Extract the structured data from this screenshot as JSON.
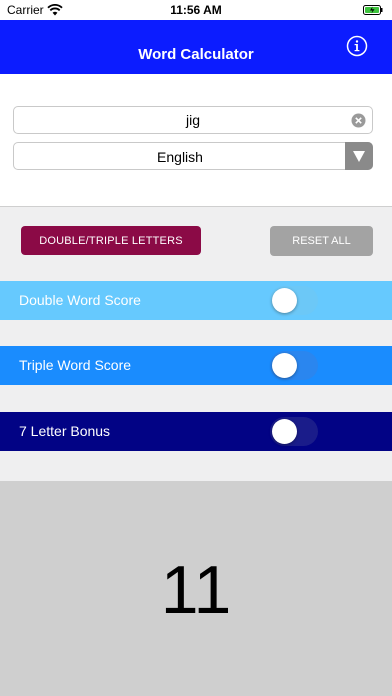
{
  "status_bar": {
    "carrier": "Carrier",
    "time": "11:56 AM"
  },
  "header": {
    "title": "Word Calculator",
    "info_icon": "info-icon"
  },
  "word_input": {
    "value": "jig",
    "clear_icon": "clear-icon"
  },
  "language": {
    "selected": "English",
    "dropdown_icon": "triangle-down-icon"
  },
  "buttons": {
    "double_triple": "DOUBLE/TRIPLE LETTERS",
    "reset": "RESET ALL"
  },
  "options": [
    {
      "label": "Double Word Score",
      "on": false,
      "color": "#66c9fe"
    },
    {
      "label": "Triple Word Score",
      "on": false,
      "color": "#1a8cfe"
    },
    {
      "label": "7 Letter Bonus",
      "on": false,
      "color": "#020385"
    }
  ],
  "score": "11",
  "colors": {
    "header": "#0c1cff",
    "letters_button": "#8b0a46",
    "reset_button": "#a3a3a3"
  }
}
